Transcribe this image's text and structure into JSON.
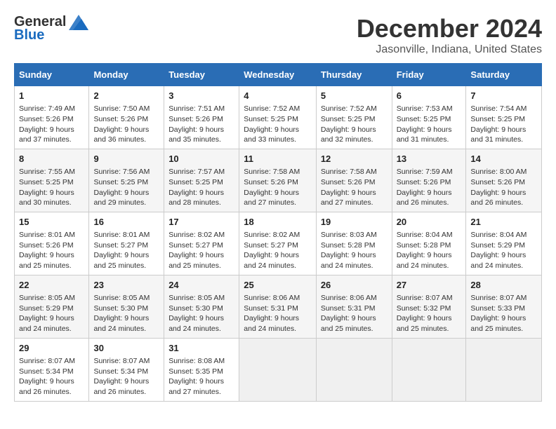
{
  "logo": {
    "general": "General",
    "blue": "Blue"
  },
  "title": "December 2024",
  "subtitle": "Jasonville, Indiana, United States",
  "days_of_week": [
    "Sunday",
    "Monday",
    "Tuesday",
    "Wednesday",
    "Thursday",
    "Friday",
    "Saturday"
  ],
  "weeks": [
    [
      {
        "day": "1",
        "info": "Sunrise: 7:49 AM\nSunset: 5:26 PM\nDaylight: 9 hours and 37 minutes."
      },
      {
        "day": "2",
        "info": "Sunrise: 7:50 AM\nSunset: 5:26 PM\nDaylight: 9 hours and 36 minutes."
      },
      {
        "day": "3",
        "info": "Sunrise: 7:51 AM\nSunset: 5:26 PM\nDaylight: 9 hours and 35 minutes."
      },
      {
        "day": "4",
        "info": "Sunrise: 7:52 AM\nSunset: 5:25 PM\nDaylight: 9 hours and 33 minutes."
      },
      {
        "day": "5",
        "info": "Sunrise: 7:52 AM\nSunset: 5:25 PM\nDaylight: 9 hours and 32 minutes."
      },
      {
        "day": "6",
        "info": "Sunrise: 7:53 AM\nSunset: 5:25 PM\nDaylight: 9 hours and 31 minutes."
      },
      {
        "day": "7",
        "info": "Sunrise: 7:54 AM\nSunset: 5:25 PM\nDaylight: 9 hours and 31 minutes."
      }
    ],
    [
      {
        "day": "8",
        "info": "Sunrise: 7:55 AM\nSunset: 5:25 PM\nDaylight: 9 hours and 30 minutes."
      },
      {
        "day": "9",
        "info": "Sunrise: 7:56 AM\nSunset: 5:25 PM\nDaylight: 9 hours and 29 minutes."
      },
      {
        "day": "10",
        "info": "Sunrise: 7:57 AM\nSunset: 5:25 PM\nDaylight: 9 hours and 28 minutes."
      },
      {
        "day": "11",
        "info": "Sunrise: 7:58 AM\nSunset: 5:26 PM\nDaylight: 9 hours and 27 minutes."
      },
      {
        "day": "12",
        "info": "Sunrise: 7:58 AM\nSunset: 5:26 PM\nDaylight: 9 hours and 27 minutes."
      },
      {
        "day": "13",
        "info": "Sunrise: 7:59 AM\nSunset: 5:26 PM\nDaylight: 9 hours and 26 minutes."
      },
      {
        "day": "14",
        "info": "Sunrise: 8:00 AM\nSunset: 5:26 PM\nDaylight: 9 hours and 26 minutes."
      }
    ],
    [
      {
        "day": "15",
        "info": "Sunrise: 8:01 AM\nSunset: 5:26 PM\nDaylight: 9 hours and 25 minutes."
      },
      {
        "day": "16",
        "info": "Sunrise: 8:01 AM\nSunset: 5:27 PM\nDaylight: 9 hours and 25 minutes."
      },
      {
        "day": "17",
        "info": "Sunrise: 8:02 AM\nSunset: 5:27 PM\nDaylight: 9 hours and 25 minutes."
      },
      {
        "day": "18",
        "info": "Sunrise: 8:02 AM\nSunset: 5:27 PM\nDaylight: 9 hours and 24 minutes."
      },
      {
        "day": "19",
        "info": "Sunrise: 8:03 AM\nSunset: 5:28 PM\nDaylight: 9 hours and 24 minutes."
      },
      {
        "day": "20",
        "info": "Sunrise: 8:04 AM\nSunset: 5:28 PM\nDaylight: 9 hours and 24 minutes."
      },
      {
        "day": "21",
        "info": "Sunrise: 8:04 AM\nSunset: 5:29 PM\nDaylight: 9 hours and 24 minutes."
      }
    ],
    [
      {
        "day": "22",
        "info": "Sunrise: 8:05 AM\nSunset: 5:29 PM\nDaylight: 9 hours and 24 minutes."
      },
      {
        "day": "23",
        "info": "Sunrise: 8:05 AM\nSunset: 5:30 PM\nDaylight: 9 hours and 24 minutes."
      },
      {
        "day": "24",
        "info": "Sunrise: 8:05 AM\nSunset: 5:30 PM\nDaylight: 9 hours and 24 minutes."
      },
      {
        "day": "25",
        "info": "Sunrise: 8:06 AM\nSunset: 5:31 PM\nDaylight: 9 hours and 24 minutes."
      },
      {
        "day": "26",
        "info": "Sunrise: 8:06 AM\nSunset: 5:31 PM\nDaylight: 9 hours and 25 minutes."
      },
      {
        "day": "27",
        "info": "Sunrise: 8:07 AM\nSunset: 5:32 PM\nDaylight: 9 hours and 25 minutes."
      },
      {
        "day": "28",
        "info": "Sunrise: 8:07 AM\nSunset: 5:33 PM\nDaylight: 9 hours and 25 minutes."
      }
    ],
    [
      {
        "day": "29",
        "info": "Sunrise: 8:07 AM\nSunset: 5:34 PM\nDaylight: 9 hours and 26 minutes."
      },
      {
        "day": "30",
        "info": "Sunrise: 8:07 AM\nSunset: 5:34 PM\nDaylight: 9 hours and 26 minutes."
      },
      {
        "day": "31",
        "info": "Sunrise: 8:08 AM\nSunset: 5:35 PM\nDaylight: 9 hours and 27 minutes."
      },
      null,
      null,
      null,
      null
    ]
  ]
}
